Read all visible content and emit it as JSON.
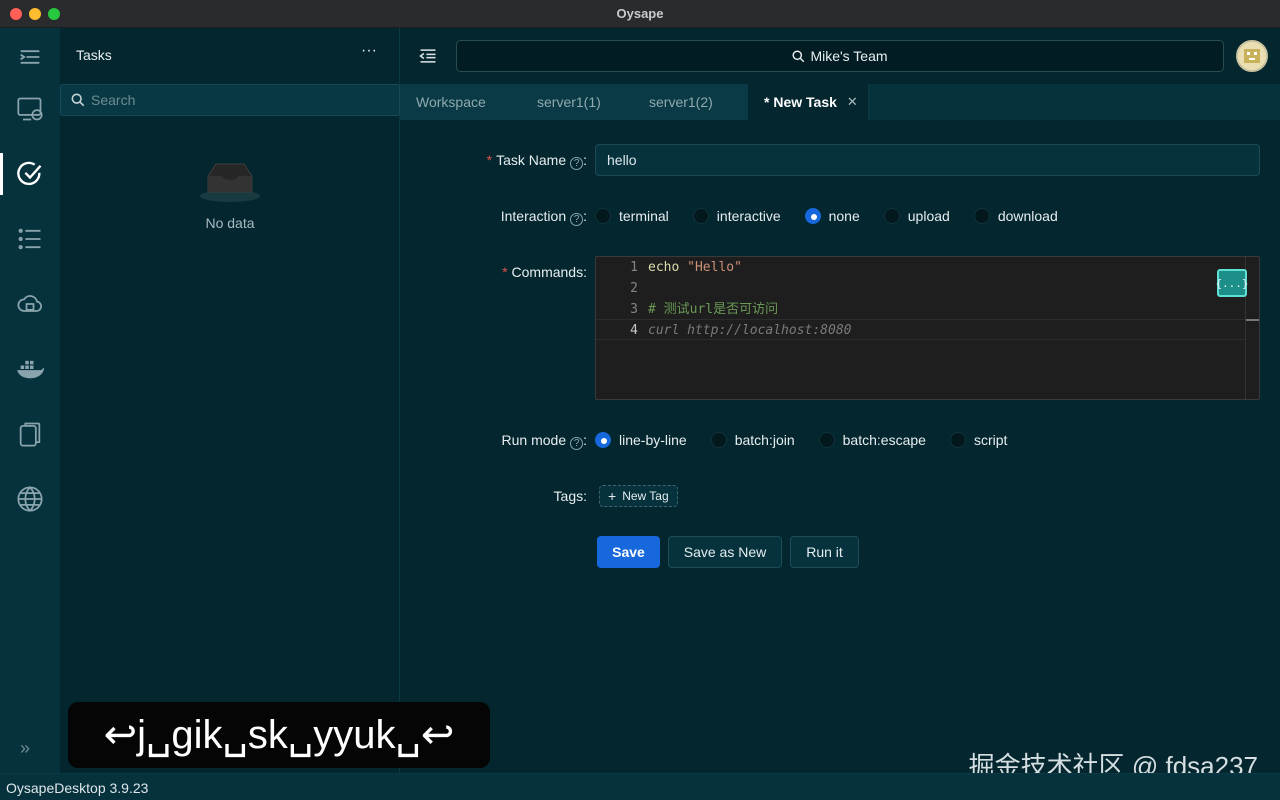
{
  "window": {
    "title": "Oysape"
  },
  "activity": {
    "items": [
      {
        "name": "server-icon"
      },
      {
        "name": "task-check-icon"
      },
      {
        "name": "pipeline-list-icon"
      },
      {
        "name": "cloud-icon"
      },
      {
        "name": "docker-icon"
      },
      {
        "name": "files-icon"
      },
      {
        "name": "globe-icon"
      }
    ],
    "collapse_glyph": "»"
  },
  "sidebar": {
    "title": "Tasks",
    "more": "···",
    "search_placeholder": "Search",
    "empty_text": "No data"
  },
  "header": {
    "search_text": "Mike's Team"
  },
  "tabs": [
    {
      "label": "Workspace"
    },
    {
      "label": "server1(1)"
    },
    {
      "label": "server1(2)"
    },
    {
      "label": "* New Task",
      "close": "✕"
    }
  ],
  "form": {
    "task_name": {
      "label": "Task Name",
      "value": "hello"
    },
    "interaction": {
      "label": "Interaction",
      "options": [
        "terminal",
        "interactive",
        "none",
        "upload",
        "download"
      ],
      "selected": "none"
    },
    "commands": {
      "label": "Commands",
      "lines": [
        {
          "num": "1",
          "text": "echo \"Hello\""
        },
        {
          "num": "2",
          "text": ""
        },
        {
          "num": "3",
          "text": "# 测试url是否可访问"
        },
        {
          "num": "4",
          "text": "curl http://localhost:8080"
        }
      ],
      "format_button": "{...}"
    },
    "run_mode": {
      "label": "Run mode",
      "options": [
        "line-by-line",
        "batch:join",
        "batch:escape",
        "script"
      ],
      "selected": "line-by-line"
    },
    "tags": {
      "label": "Tags",
      "new_tag": "New Tag"
    },
    "buttons": {
      "save": "Save",
      "save_as_new": "Save as New",
      "run": "Run it"
    }
  },
  "overlay": {
    "keystrokes": "↩j␣gik␣sk␣yyuk␣↩",
    "watermark": "掘金技术社区 @ fdsa237"
  },
  "status": {
    "version": "OysapeDesktop 3.9.23"
  },
  "colors": {
    "accent": "#1668dc",
    "background": "#03262f",
    "sidebar": "#05323d",
    "required": "#e0544d"
  }
}
